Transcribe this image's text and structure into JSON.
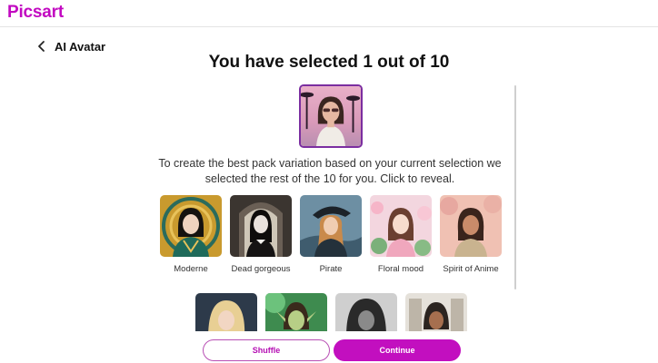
{
  "app": {
    "logo": "Picsart"
  },
  "header": {
    "back_icon": "chevron-left-icon",
    "crumb": "AI Avatar"
  },
  "main": {
    "title": "You have selected 1 out of 10",
    "description": "To create the best pack variation based on your current selection we selected the rest of the 10 for you. Click to reveal.",
    "styles": [
      {
        "label": "Moderne"
      },
      {
        "label": "Dead gorgeous"
      },
      {
        "label": "Pirate"
      },
      {
        "label": "Floral mood"
      },
      {
        "label": "Spirit of Anime"
      }
    ]
  },
  "footer": {
    "shuffle_label": "Shuffle",
    "continue_label": "Continue"
  },
  "colors": {
    "brand": "#c209c1",
    "selected_border": "#7b2ea0"
  }
}
